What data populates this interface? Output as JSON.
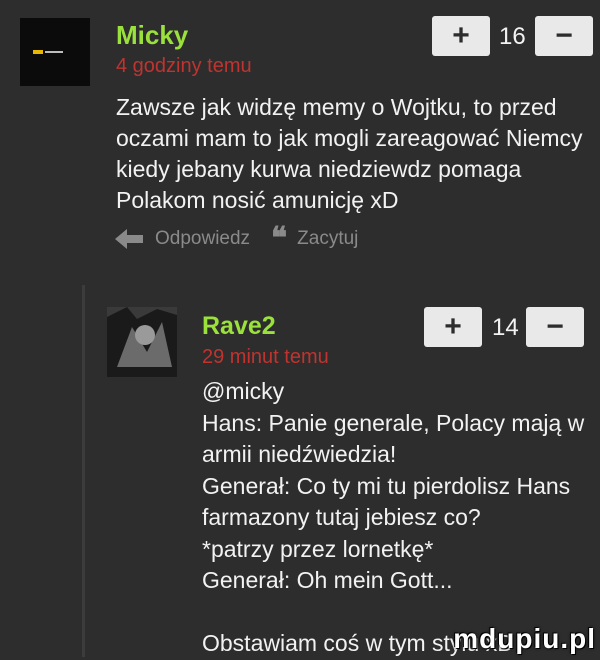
{
  "comment1": {
    "username": "Micky",
    "time": "4 godziny temu",
    "score": "16",
    "text": "Zawsze jak widzę memy o Wojtku, to przed\noczami mam to jak mogli zareagować Niemcy\nkiedy jebany kurwa niedziewdz pomaga\nPolakom nosić amunicję xD",
    "reply_label": "Odpowiedz",
    "quote_label": "Zacytuj"
  },
  "comment2": {
    "username": "Rave2",
    "time": "29 minut temu",
    "score": "14",
    "text": "@micky\nHans: Panie generale, Polacy mają w\narmii niedźwiedzia!\nGenerał: Co ty mi tu pierdolisz Hans\nfarmazony tutaj jebiesz co?\n*patrzy przez lornetkę*\nGenerał: Oh mein Gott...\n\nObstawiam coś w tym stylu xD"
  },
  "vote": {
    "plus": "+",
    "minus": "−"
  },
  "watermark": "mdupiu.pl",
  "colors": {
    "username": "#9be13b",
    "time": "#c0332f",
    "background": "#2d2d2d"
  }
}
